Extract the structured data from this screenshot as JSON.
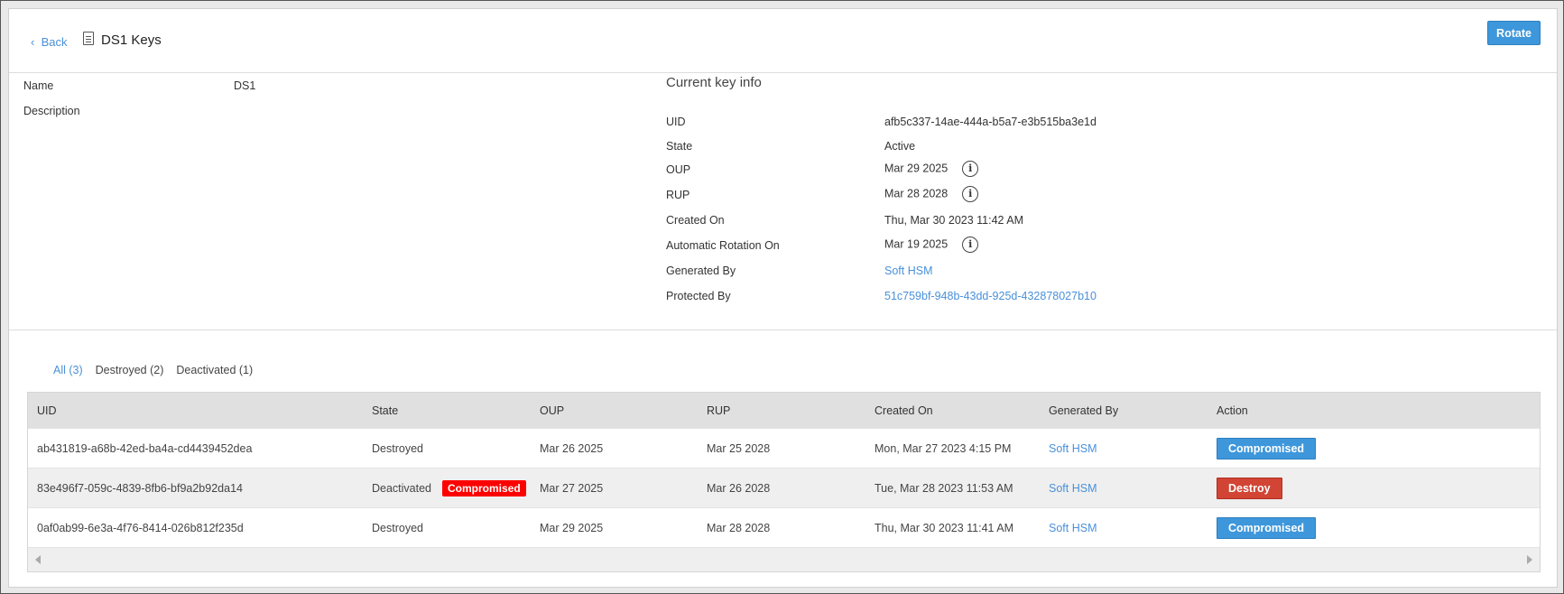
{
  "header": {
    "back_label": "Back",
    "title": "DS1 Keys",
    "rotate_label": "Rotate",
    "doc_icon": "document-icon"
  },
  "details": {
    "name_label": "Name",
    "name_value": "DS1",
    "description_label": "Description"
  },
  "current_key": {
    "heading": "Current key info",
    "rows": [
      {
        "label": "UID",
        "value": "afb5c337-14ae-444a-b5a7-e3b515ba3e1d"
      },
      {
        "label": "State",
        "value": "Active"
      },
      {
        "label": "OUP",
        "value": "Mar 29 2025",
        "info": true
      },
      {
        "label": "RUP",
        "value": "Mar 28 2028",
        "info": true
      },
      {
        "label": "Created On",
        "value": "Thu, Mar 30 2023 11:42 AM"
      },
      {
        "label": "Automatic Rotation On",
        "value": "Mar 19 2025",
        "info": true
      },
      {
        "label": "Generated By",
        "value": "Soft HSM",
        "link": true
      },
      {
        "label": "Protected By",
        "value": "51c759bf-948b-43dd-925d-432878027b10",
        "link": true
      }
    ],
    "info_glyph": "i"
  },
  "tabs": [
    {
      "label": "All (3)",
      "active": true
    },
    {
      "label": "Destroyed (2)"
    },
    {
      "label": "Deactivated (1)"
    }
  ],
  "table": {
    "columns": [
      "UID",
      "State",
      "OUP",
      "RUP",
      "Created On",
      "Generated By",
      "Action"
    ],
    "rows": [
      {
        "uid": "ab431819-a68b-42ed-ba4a-cd4439452dea",
        "state": "Destroyed",
        "badge": "",
        "oup": "Mar 26 2025",
        "rup": "Mar 25 2028",
        "created": "Mon, Mar 27 2023 4:15 PM",
        "generated": "Soft HSM",
        "action": "Compromised",
        "action_color": "#3e97db"
      },
      {
        "uid": "83e496f7-059c-4839-8fb6-bf9a2b92da14",
        "state": "Deactivated",
        "badge": "Compromised",
        "oup": "Mar 27 2025",
        "rup": "Mar 26 2028",
        "created": "Tue, Mar 28 2023 11:53 AM",
        "generated": "Soft HSM",
        "action": "Destroy",
        "action_color": "#d24434"
      },
      {
        "uid": "0af0ab99-6e3a-4f76-8414-026b812f235d",
        "state": "Destroyed",
        "badge": "",
        "oup": "Mar 29 2025",
        "rup": "Mar 28 2028",
        "created": "Thu, Mar 30 2023 11:41 AM",
        "generated": "Soft HSM",
        "action": "Compromised",
        "action_color": "#3e97db"
      }
    ]
  },
  "colors": {
    "accent": "#4a90d9",
    "primary_button": "#3e97db",
    "destroy_button": "#d24434",
    "compromised_badge": "#ff0000"
  }
}
